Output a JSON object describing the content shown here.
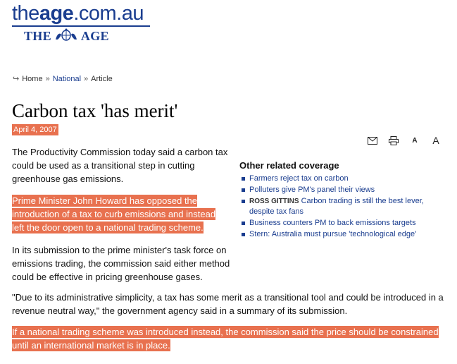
{
  "masthead": {
    "logo_light": "the",
    "logo_bold": "age",
    "logo_domain": ".com.au",
    "sub_left": "THE",
    "sub_right": "AGE",
    "crest_icon": "coat-of-arms-icon",
    "brand_color": "#1a3d8f"
  },
  "breadcrumb": {
    "icon": "return-arrow-icon",
    "home": "Home",
    "section": "National",
    "page": "Article",
    "separator": "»"
  },
  "article": {
    "headline": "Carbon tax 'has merit'",
    "date": "April 4, 2007",
    "highlight_color": "#e8714f",
    "paragraphs": [
      "The Productivity Commission today said a carbon tax could be used as a transitional step in cutting greenhouse gas emissions.",
      "Prime Minister John Howard has opposed the introduction of a tax to curb emissions and instead left the door open to a national trading scheme.",
      "In its submission to the prime minister's task force on emissions trading, the commission said either method could be effective in pricing greenhouse gases.",
      "\"Due to its administrative simplicity, a tax has some merit as a transitional tool and could be introduced in a revenue neutral way,\" the government agency said in a summary of its submission.",
      "If a national trading scheme was introduced instead, the commission said the price should be constrained until an international market is in place."
    ]
  },
  "toolbar": {
    "email_icon": "email-icon",
    "print_icon": "print-icon",
    "small_text": "A",
    "large_text": "A"
  },
  "related": {
    "title": "Other related coverage",
    "items": [
      {
        "kicker": "",
        "text": "Farmers reject tax on carbon"
      },
      {
        "kicker": "",
        "text": "Polluters give PM's panel their views"
      },
      {
        "kicker": "ROSS GITTINS",
        "text": "Carbon trading is still the best lever, despite tax fans"
      },
      {
        "kicker": "",
        "text": "Business counters PM to back emissions targets"
      },
      {
        "kicker": "",
        "text": "Stern: Australia must pursue 'technological edge'"
      }
    ]
  }
}
